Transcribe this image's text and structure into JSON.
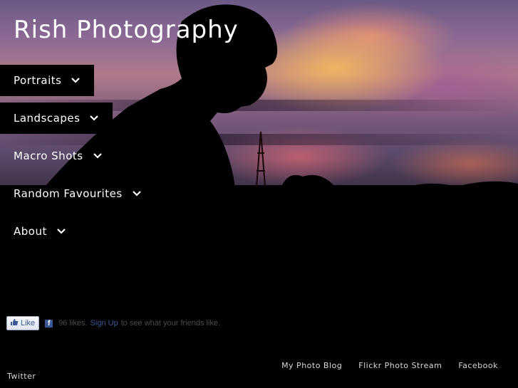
{
  "site": {
    "title": "Rish Photography"
  },
  "nav": [
    {
      "label": "Portraits"
    },
    {
      "label": "Landscapes"
    },
    {
      "label": "Macro Shots"
    },
    {
      "label": "Random Favourites"
    },
    {
      "label": "About"
    }
  ],
  "facebook": {
    "like_label": "Like",
    "count_text": "96 likes.",
    "signup_label": "Sign Up",
    "signup_suffix": "to see what your friends like."
  },
  "footer": {
    "links": [
      "My Photo Blog",
      "Flickr Photo Stream",
      "Facebook"
    ],
    "twitter": "Twitter"
  },
  "icons": {
    "chevron": "chevron-down-icon",
    "thumb": "thumbs-up-icon",
    "facebook": "facebook-icon"
  }
}
